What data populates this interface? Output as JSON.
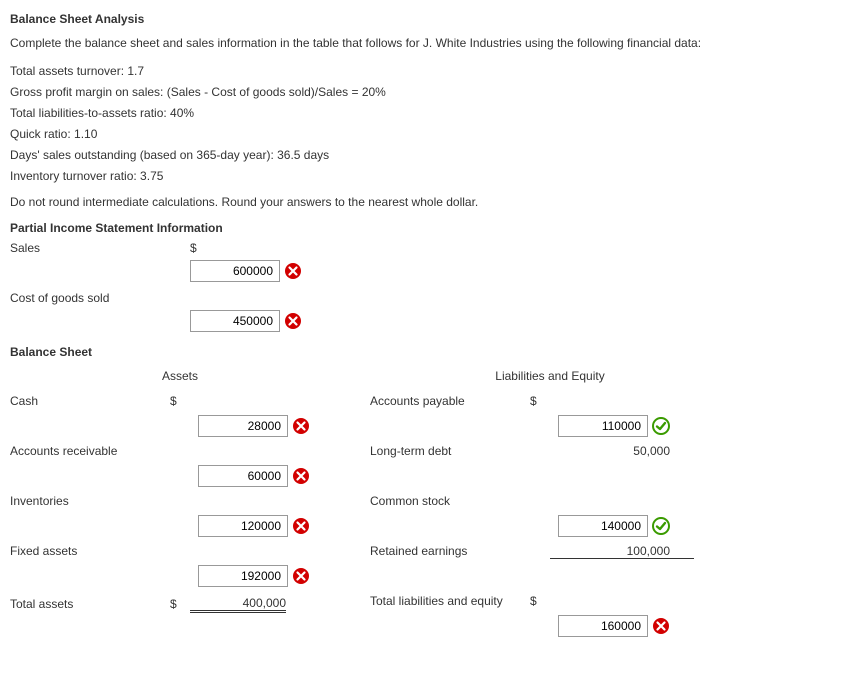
{
  "title": "Balance Sheet Analysis",
  "intro": "Complete the balance sheet and sales information in the table that follows for J. White Industries using the following financial data:",
  "financial_data": [
    "Total assets turnover: 1.7",
    "Gross profit margin on sales: (Sales - Cost of goods sold)/Sales = 20%",
    "Total liabilities-to-assets ratio: 40%",
    "Quick ratio: 1.10",
    "Days' sales outstanding (based on 365-day year): 36.5 days",
    "Inventory turnover ratio: 3.75"
  ],
  "rounding_note": "Do not round intermediate calculations. Round your answers to the nearest whole dollar.",
  "income_section_title": "Partial Income Statement Information",
  "income": {
    "sales_label": "Sales",
    "sales_value": "600000",
    "cogs_label": "Cost of goods sold",
    "cogs_value": "450000"
  },
  "balance_sheet_title": "Balance Sheet",
  "assets_header": "Assets",
  "liab_header": "Liabilities and Equity",
  "assets": {
    "cash_label": "Cash",
    "cash_value": "28000",
    "ar_label": "Accounts receivable",
    "ar_value": "60000",
    "inv_label": "Inventories",
    "inv_value": "120000",
    "fixed_label": "Fixed assets",
    "fixed_value": "192000",
    "total_label": "Total assets",
    "total_value": "400,000"
  },
  "liab": {
    "ap_label": "Accounts payable",
    "ap_value": "110000",
    "ltd_label": "Long-term debt",
    "ltd_value": "50,000",
    "cs_label": "Common stock",
    "cs_value": "140000",
    "re_label": "Retained earnings",
    "re_value": "100,000",
    "total_label": "Total liabilities and equity",
    "total_value": "160000"
  },
  "dollar": "$"
}
